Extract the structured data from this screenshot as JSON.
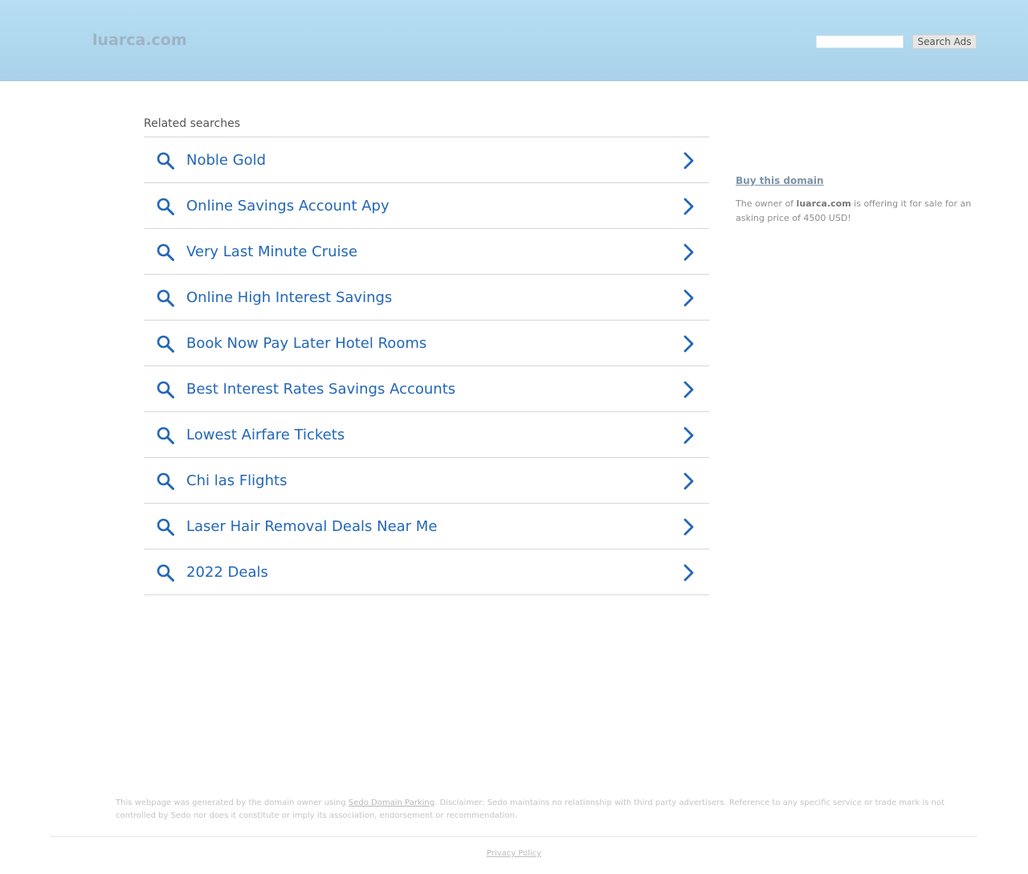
{
  "header": {
    "logo": "luarca.com",
    "search_value": "",
    "search_button": "Search Ads"
  },
  "related": {
    "title": "Related searches",
    "items": [
      {
        "label": "Noble Gold"
      },
      {
        "label": "Online Savings Account Apy"
      },
      {
        "label": "Very Last Minute Cruise"
      },
      {
        "label": "Online High Interest Savings"
      },
      {
        "label": "Book Now Pay Later Hotel Rooms"
      },
      {
        "label": "Best Interest Rates Savings Accounts"
      },
      {
        "label": "Lowest Airfare Tickets"
      },
      {
        "label": "Chi las Flights"
      },
      {
        "label": "Laser Hair Removal Deals Near Me"
      },
      {
        "label": "2022 Deals"
      }
    ]
  },
  "sidebar": {
    "buy_link": "Buy this domain",
    "offer_prefix": "The owner of ",
    "offer_domain": "luarca.com",
    "offer_suffix": " is offering it for sale for an asking price of 4500 USD!"
  },
  "footer": {
    "disclaimer_prefix": "This webpage was generated by the domain owner using ",
    "disclaimer_link": "Sedo Domain Parking",
    "disclaimer_suffix": ". Disclaimer: Sedo maintains no relationship with third party advertisers. Reference to any specific service or trade mark is not controlled by Sedo nor does it constitute or imply its association, endorsement or recommendation.",
    "privacy": "Privacy Policy"
  },
  "colors": {
    "link_blue": "#2367b7",
    "header_bg": "#b7def2"
  },
  "icons": {
    "result_icon": "search-icon",
    "result_arrow": "chevron-right-icon"
  }
}
